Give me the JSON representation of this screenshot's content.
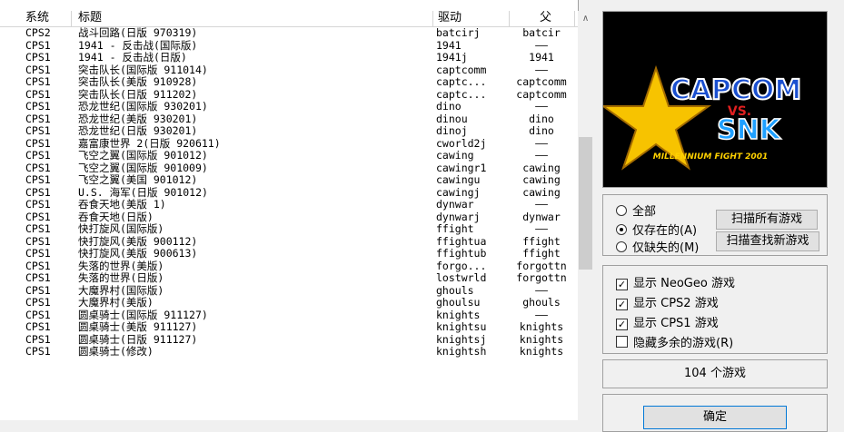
{
  "columns": {
    "system": "系统",
    "title": "标题",
    "driver": "驱动",
    "parent": "父"
  },
  "rows": [
    {
      "system": "CPS2",
      "title": "战斗回路(日版 970319)",
      "driver": "batcirj",
      "parent": "batcir"
    },
    {
      "system": "CPS1",
      "title": "1941 - 反击战(国际版)",
      "driver": "1941",
      "parent": "——"
    },
    {
      "system": "CPS1",
      "title": "1941 - 反击战(日版)",
      "driver": "1941j",
      "parent": "1941"
    },
    {
      "system": "CPS1",
      "title": "突击队长(国际版 911014)",
      "driver": "captcomm",
      "parent": "——"
    },
    {
      "system": "CPS1",
      "title": "突击队长(美版 910928)",
      "driver": "captc...",
      "parent": "captcomm"
    },
    {
      "system": "CPS1",
      "title": "突击队长(日版 911202)",
      "driver": "captc...",
      "parent": "captcomm"
    },
    {
      "system": "CPS1",
      "title": "恐龙世纪(国际版 930201)",
      "driver": "dino",
      "parent": "——"
    },
    {
      "system": "CPS1",
      "title": "恐龙世纪(美版 930201)",
      "driver": "dinou",
      "parent": "dino"
    },
    {
      "system": "CPS1",
      "title": "恐龙世纪(日版 930201)",
      "driver": "dinoj",
      "parent": "dino"
    },
    {
      "system": "CPS1",
      "title": "嘉富康世界 2(日版 920611)",
      "driver": "cworld2j",
      "parent": "——"
    },
    {
      "system": "CPS1",
      "title": "飞空之翼(国际版 901012)",
      "driver": "cawing",
      "parent": "——"
    },
    {
      "system": "CPS1",
      "title": "飞空之翼(国际版 901009)",
      "driver": "cawingr1",
      "parent": "cawing"
    },
    {
      "system": "CPS1",
      "title": "飞空之翼(美国 901012)",
      "driver": "cawingu",
      "parent": "cawing"
    },
    {
      "system": "CPS1",
      "title": "U.S. 海军(日版 901012)",
      "driver": "cawingj",
      "parent": "cawing"
    },
    {
      "system": "CPS1",
      "title": "吞食天地(美版 1)",
      "driver": "dynwar",
      "parent": "——"
    },
    {
      "system": "CPS1",
      "title": "吞食天地(日版)",
      "driver": "dynwarj",
      "parent": "dynwar"
    },
    {
      "system": "CPS1",
      "title": "快打旋风(国际版)",
      "driver": "ffight",
      "parent": "——"
    },
    {
      "system": "CPS1",
      "title": "快打旋风(美版 900112)",
      "driver": "ffightua",
      "parent": "ffight"
    },
    {
      "system": "CPS1",
      "title": "快打旋风(美版 900613)",
      "driver": "ffightub",
      "parent": "ffight"
    },
    {
      "system": "CPS1",
      "title": "失落的世界(美版)",
      "driver": "forgo...",
      "parent": "forgottn"
    },
    {
      "system": "CPS1",
      "title": "失落的世界(日版)",
      "driver": "lostwrld",
      "parent": "forgottn"
    },
    {
      "system": "CPS1",
      "title": "大魔界村(国际版)",
      "driver": "ghouls",
      "parent": "——"
    },
    {
      "system": "CPS1",
      "title": "大魔界村(美版)",
      "driver": "ghoulsu",
      "parent": "ghouls"
    },
    {
      "system": "CPS1",
      "title": "圆桌骑士(国际版 911127)",
      "driver": "knights",
      "parent": "——"
    },
    {
      "system": "CPS1",
      "title": "圆桌骑士(美版 911127)",
      "driver": "knightsu",
      "parent": "knights"
    },
    {
      "system": "CPS1",
      "title": "圆桌骑士(日版 911127)",
      "driver": "knightsj",
      "parent": "knights"
    },
    {
      "system": "CPS1",
      "title": "圆桌骑士(修改)",
      "driver": "knightsh",
      "parent": "knights"
    }
  ],
  "preview": {
    "logo_top": "CAPCOM",
    "logo_vs": "VS.",
    "logo_bottom": "SNK",
    "tagline": "MILLENNIUM FIGHT 2001"
  },
  "filter": {
    "all": "全部",
    "existing": "仅存在的(A)",
    "missing": "仅缺失的(M)",
    "scan_all": "扫描所有游戏",
    "scan_new": "扫描查找新游戏"
  },
  "options": [
    {
      "label": "显示 NeoGeo 游戏",
      "checked": true
    },
    {
      "label": "显示 CPS2 游戏",
      "checked": true
    },
    {
      "label": "显示 CPS1 游戏",
      "checked": true
    },
    {
      "label": "隐藏多余的游戏(R)",
      "checked": false
    }
  ],
  "count_text": "104 个游戏",
  "ok_label": "确定"
}
